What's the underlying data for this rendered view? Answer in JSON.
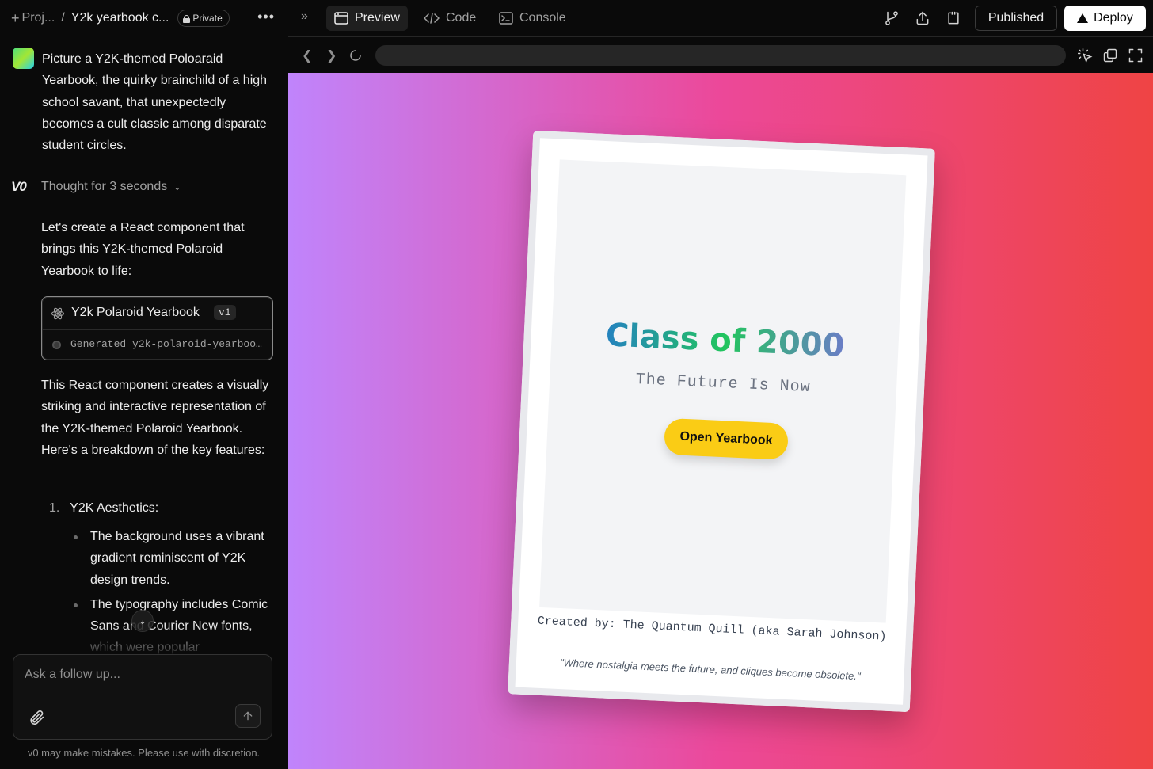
{
  "sidebar": {
    "breadcrumb": {
      "plus": "+",
      "project": "Proj...",
      "separator": "/",
      "title": "Y2k yearbook c..."
    },
    "private_label": "Private",
    "more": "•••",
    "user_message": "Picture a Y2K-themed Poloaraid Yearbook, the quirky brainchild of a high school savant, that unexpectedly becomes a cult classic among disparate student circles.",
    "logo": "V0",
    "thought": "Thought for 3 seconds",
    "intro": "Let's create a React component that brings this Y2K-themed Polaroid Yearbook to life:",
    "artifact": {
      "title": "Y2k Polaroid Yearbook",
      "version": "v1",
      "status": "Generated y2k-polaroid-yearbook.tsx"
    },
    "description": "This React component creates a visually striking and interactive representation of the Y2K-themed Polaroid Yearbook. Here's a breakdown of the key features:",
    "list": [
      {
        "number": "1.",
        "label": "Y2K Aesthetics:"
      }
    ],
    "bullets": [
      "The background uses a vibrant gradient reminiscent of Y2K design trends.",
      "The typography includes Comic Sans and Courier New fonts, which were popular"
    ],
    "composer_placeholder": "Ask a follow up...",
    "disclaimer": "v0 may make mistakes. Please use with discretion."
  },
  "toolbar": {
    "tabs": [
      {
        "label": "Preview",
        "icon": "browser-window-icon",
        "active": true
      },
      {
        "label": "Code",
        "icon": "code-icon",
        "active": false
      },
      {
        "label": "Console",
        "icon": "terminal-icon",
        "active": false
      }
    ],
    "published_label": "Published",
    "deploy_label": "Deploy"
  },
  "addressbar": {
    "url": ""
  },
  "preview": {
    "title": "Class of 2000",
    "subtitle": "The Future Is Now",
    "button": "Open Yearbook",
    "created_by": "Created by: The Quantum Quill (aka Sarah Johnson)",
    "quote": "\"Where nostalgia meets the future, and cliques become obsolete.\""
  },
  "colors": {
    "accent_button": "#facc15",
    "gradient_start": "#c084fc",
    "gradient_mid": "#ec4899",
    "gradient_end": "#ef4444"
  }
}
